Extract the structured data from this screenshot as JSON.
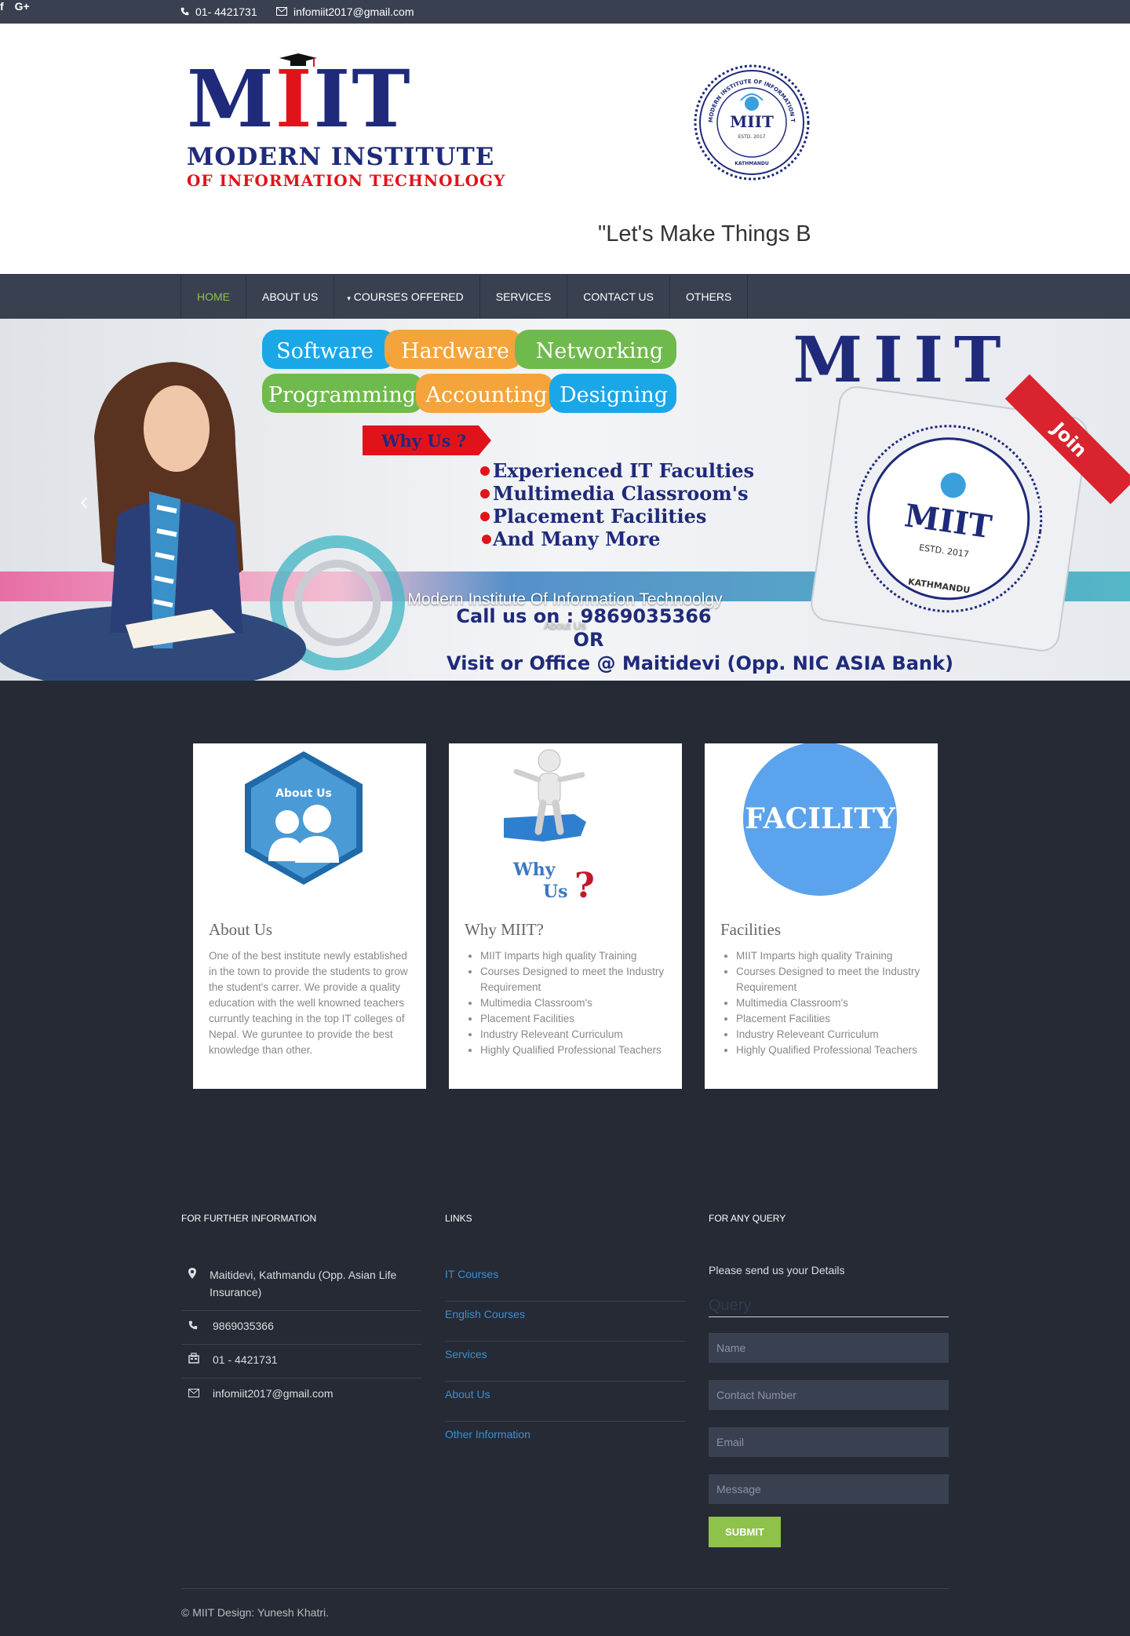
{
  "topbar": {
    "phone": "01- 4421731",
    "email": "infomiit2017@gmail.com",
    "social": [
      "f",
      "G+"
    ]
  },
  "header": {
    "logo_big_prefix": "M",
    "logo_big_red": "I",
    "logo_big_suffix": "IT",
    "logo_line1": "MODERN INSTITUTE",
    "logo_line2": "OF INFORMATION TECHNOLOGY",
    "seal_name": "MODERN INSTITUTE OF INFORMATION TECHNOLOGY",
    "seal_abbr": "MIIT",
    "seal_est": "ESTD. 2017",
    "seal_city": "KATHMANDU",
    "tagline": "\"Let's Make Things Better\""
  },
  "nav": {
    "items": [
      "HOME",
      "ABOUT US",
      "COURSES OFFERED",
      "SERVICES",
      "CONTACT US",
      "OTHERS"
    ]
  },
  "banner": {
    "tags": [
      "Software",
      "Hardware",
      "Networking",
      "Programming",
      "Accounting",
      "Designing"
    ],
    "why": "Why Us ?",
    "bullets": [
      "Experienced IT Faculties",
      "Multimedia Classroom's",
      "Placement Facilities",
      "And Many More"
    ],
    "brand": "MIIT",
    "ribbon": "Join",
    "call": "Call us on : 9869035366",
    "or": "OR",
    "visit": "Visit or Office @ Maitidevi (Opp. NIC ASIA Bank)",
    "caption": "Modern Institute Of Information Technoolgy",
    "caption_sub": "About Us",
    "tag_colors": [
      "#1aa7e8",
      "#f4a43a",
      "#6fba4c",
      "#6fba4c",
      "#f4a43a",
      "#1aa7e8"
    ]
  },
  "features": {
    "about": {
      "img_label": "About Us",
      "title": "About Us",
      "text": "One of the best institute newly established in the town to provide the students to grow the student's carrer. We provide a quality education with the well knowned teachers curruntly teaching in the top IT colleges of Nepal. We guruntee to provide the best knowledge than other."
    },
    "why": {
      "img_label1": "Why",
      "img_label2": "Us",
      "img_q": "?",
      "title": "Why MIIT?",
      "items": [
        "MIIT Imparts high quality Training",
        "Courses Designed to meet the Industry Requirement",
        "Multimedia Classroom's",
        "Placement Facilities",
        "Industry Releveant Curriculum",
        "Highly Qualified Professional Teachers"
      ]
    },
    "facilities": {
      "img_label": "FACILITY",
      "title": "Facilities",
      "items": [
        "MIIT Imparts high quality Training",
        "Courses Designed to meet the Industry Requirement",
        "Multimedia Classroom's",
        "Placement Facilities",
        "Industry Releveant Curriculum",
        "Highly Qualified Professional Teachers"
      ]
    }
  },
  "footer": {
    "col1_title": "FOR FURTHER INFORMATION",
    "contacts": [
      {
        "icon": "map-pin-icon",
        "text": "Maitidevi, Kathmandu (Opp. Asian Life Insurance)"
      },
      {
        "icon": "phone-icon",
        "text": "9869035366"
      },
      {
        "icon": "fax-icon",
        "text": "01 - 4421731"
      },
      {
        "icon": "envelope-icon",
        "text": "infomiit2017@gmail.com"
      }
    ],
    "col2_title": "LINKS",
    "links": [
      "IT Courses",
      "English Courses",
      "Services",
      "About Us",
      "Other Information"
    ],
    "col3_title": "FOR ANY QUERY",
    "send_text": "Please send us your Details",
    "query_label": "Query",
    "placeholders": {
      "name": "Name",
      "contact": "Contact Number",
      "email": "Email",
      "message": "Message"
    },
    "submit": "SUBMIT",
    "copyright": "© MIIT Design: Yunesh Khatri."
  }
}
